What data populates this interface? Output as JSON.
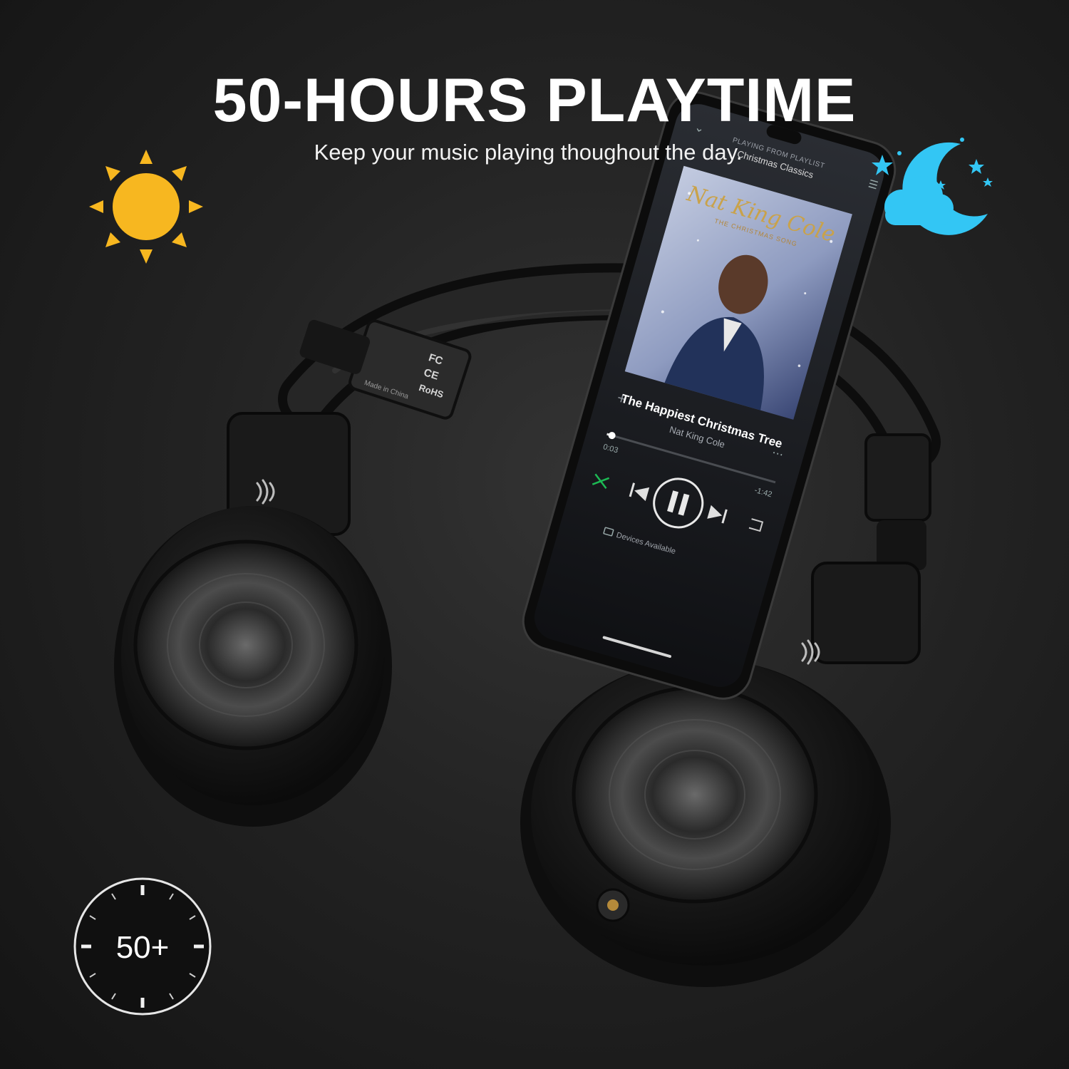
{
  "banner": {
    "title": "50-HOURS PLAYTIME",
    "subtitle": "Keep your music playing thoughout the day."
  },
  "phone": {
    "context_label": "PLAYING FROM PLAYLIST",
    "playlist": "Christmas Classics",
    "album_artist_script": "Nat King Cole",
    "album_title": "THE CHRISTMAS SONG",
    "track_title": "The Happiest Christmas Tree",
    "track_artist": "Nat King Cole",
    "elapsed": "0:03",
    "remaining": "-1:42",
    "devices_label": "Devices Available",
    "progress_fraction": 0.03
  },
  "headphones": {
    "ce_mark": "CE",
    "fc_mark": "FC",
    "rohs_mark": "RoHS",
    "origin": "Made in China"
  },
  "badge": {
    "value": "50+"
  },
  "colors": {
    "sun": "#f7b720",
    "moon": "#33c6f4",
    "accent_green": "#1db954"
  },
  "icons": [
    "sun-icon",
    "moon-icon",
    "star-icon",
    "cloud-icon",
    "stopwatch-icon",
    "play-pause-icon",
    "skip-next-icon",
    "skip-previous-icon",
    "shuffle-icon",
    "repeat-icon",
    "add-icon",
    "chevron-down-icon",
    "queue-icon",
    "more-icon",
    "devices-icon",
    "brand-logo-icon"
  ]
}
